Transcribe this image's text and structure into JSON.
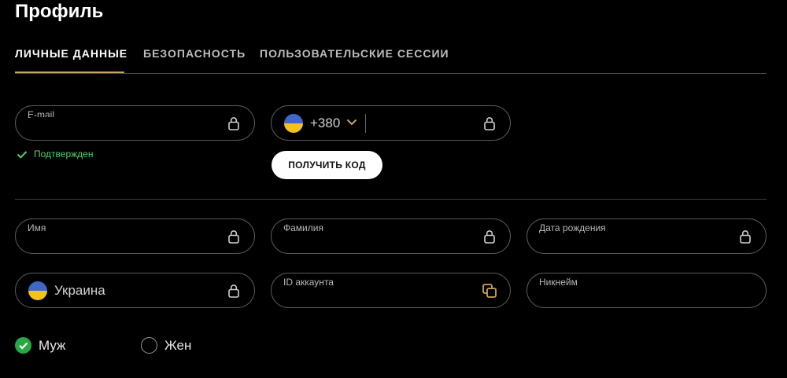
{
  "page": {
    "title": "Профиль"
  },
  "tabs": [
    {
      "label": "ЛИЧНЫЕ ДАННЫЕ",
      "active": true
    },
    {
      "label": "БЕЗОПАСНОСТЬ",
      "active": false
    },
    {
      "label": "ПОЛЬЗОВАТЕЛЬСКИЕ СЕССИИ",
      "active": false
    }
  ],
  "contact": {
    "email_label": "E-mail",
    "email_status": "Подтвержден",
    "phone_code": "+380",
    "get_code_label": "ПОЛУЧИТЬ КОД"
  },
  "personal": {
    "first_name_label": "Имя",
    "last_name_label": "Фамилия",
    "birth_date_label": "Дата рождения",
    "country_value": "Украина",
    "account_id_label": "ID аккаунта",
    "nickname_label": "Никнейм"
  },
  "gender": {
    "male_label": "Муж",
    "female_label": "Жен",
    "selected": "male"
  },
  "colors": {
    "accent_gold": "#c9a45e",
    "success_green": "#52d070",
    "radio_green": "#27a844",
    "flag_blue": "#3f67c9",
    "flag_yellow": "#f4c21a"
  },
  "icons": {
    "lock": "lock-icon",
    "copy": "copy-icon",
    "check": "check-icon",
    "chevron": "chevron-down-icon",
    "flag": "ukraine-flag-icon"
  }
}
